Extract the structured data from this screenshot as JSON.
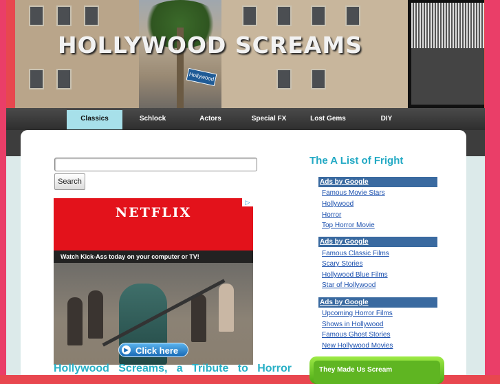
{
  "site": {
    "title": "HOLLYWOOD  SCREAMS",
    "sign_text": "Hollywood"
  },
  "nav": {
    "tabs": [
      {
        "label": "Classics"
      },
      {
        "label": "Schlock"
      },
      {
        "label": "Actors"
      },
      {
        "label": "Special FX"
      },
      {
        "label": "Lost Gems"
      },
      {
        "label": "DIY"
      }
    ],
    "active": "Classics"
  },
  "search": {
    "value": "",
    "button_label": "Search"
  },
  "ad_banner": {
    "brand": "NETFLIX",
    "tagline": "Watch Kick-Ass today on your computer or TV!",
    "cta": "Click here",
    "adchoices_icon": "adchoices-icon"
  },
  "main_heading": "Hollywood Screams, a Tribute to Horror",
  "sidebar": {
    "title": "The A List of Fright",
    "ad_groups": [
      {
        "head": "Ads by Google",
        "links": [
          "Famous Movie Stars",
          "Hollywood",
          "Horror",
          "Top Horror Movie"
        ]
      },
      {
        "head": "Ads by Google",
        "links": [
          "Famous Classic Films",
          "Scary Stories",
          "Hollywood Blue Films",
          "Star of Hollywood"
        ]
      },
      {
        "head": "Ads by Google",
        "links": [
          "Upcoming Horror Films",
          "Shows in Hollywood",
          "Famous Ghost Stories",
          "New Hollywood Movies"
        ]
      }
    ],
    "box_title": "They Made Us Scream"
  },
  "colors": {
    "accent": "#28b0c6",
    "brand_pink": "#ea3e68",
    "nav_active": "#a7e0ea",
    "ad_header": "#3a6aa0",
    "green": "#5fb522"
  }
}
